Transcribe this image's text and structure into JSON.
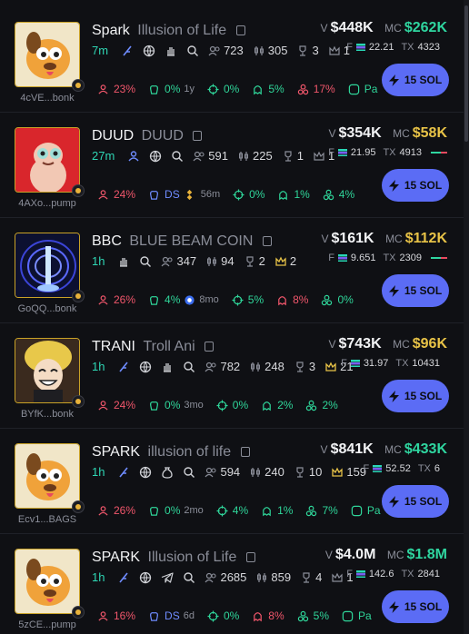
{
  "buy_label": "15 SOL",
  "colors": {
    "accent": "#5b6cf5",
    "green": "#2fd6a0",
    "yellow": "#e8c347",
    "red": "#f0566b"
  },
  "tokens": [
    {
      "address": "4cVE...bonk",
      "symbol": "Spark",
      "name": "Illusion of Life",
      "age": "7m",
      "holders": "723",
      "txns": "305",
      "trophies": "3",
      "crown": "1",
      "volume_label": "V",
      "volume": "$448K",
      "mc_label": "MC",
      "mc": "$262K",
      "mc_color": "green",
      "f_label": "F",
      "fees": "22.21",
      "tx_label": "TX",
      "tx": "4323",
      "top10": "23%",
      "dev": "0%",
      "dev_age": "1y",
      "snipers": "0%",
      "insiders": "5%",
      "bundlers": "17%",
      "paid": "Pa"
    },
    {
      "address": "4AXo...pump",
      "symbol": "DUUD",
      "name": "DUUD",
      "age": "27m",
      "holders": "591",
      "txns": "225",
      "trophies": "1",
      "crown": "1",
      "volume_label": "V",
      "volume": "$354K",
      "mc_label": "MC",
      "mc": "$58K",
      "mc_color": "yellow",
      "f_label": "F",
      "fees": "21.95",
      "tx_label": "TX",
      "tx": "4913",
      "top10": "24%",
      "dev": "DS",
      "dev_age": "56m",
      "snipers": "0%",
      "insiders": "1%",
      "bundlers": "4%",
      "paid": ""
    },
    {
      "address": "GoQQ...bonk",
      "symbol": "BBC",
      "name": "BLUE BEAM COIN",
      "age": "1h",
      "holders": "347",
      "txns": "94",
      "trophies": "2",
      "crown": "2",
      "volume_label": "V",
      "volume": "$161K",
      "mc_label": "MC",
      "mc": "$112K",
      "mc_color": "yellow",
      "f_label": "F",
      "fees": "9.651",
      "tx_label": "TX",
      "tx": "2309",
      "top10": "26%",
      "dev": "4%",
      "dev_age": "8mo",
      "snipers": "5%",
      "insiders": "8%",
      "bundlers": "0%",
      "paid": ""
    },
    {
      "address": "BYfK...bonk",
      "symbol": "TRANI",
      "name": "Troll Ani",
      "age": "1h",
      "holders": "782",
      "txns": "248",
      "trophies": "3",
      "crown": "21",
      "volume_label": "V",
      "volume": "$743K",
      "mc_label": "MC",
      "mc": "$96K",
      "mc_color": "yellow",
      "f_label": "F",
      "fees": "31.97",
      "tx_label": "TX",
      "tx": "10431",
      "top10": "24%",
      "dev": "0%",
      "dev_age": "3mo",
      "snipers": "0%",
      "insiders": "2%",
      "bundlers": "2%",
      "paid": ""
    },
    {
      "address": "Ecv1...BAGS",
      "symbol": "SPARK",
      "name": "illusion of life",
      "age": "1h",
      "holders": "594",
      "txns": "240",
      "trophies": "10",
      "crown": "159",
      "volume_label": "V",
      "volume": "$841K",
      "mc_label": "MC",
      "mc": "$433K",
      "mc_color": "green",
      "f_label": "F",
      "fees": "52.52",
      "tx_label": "TX",
      "tx": "6",
      "top10": "26%",
      "dev": "0%",
      "dev_age": "2mo",
      "snipers": "4%",
      "insiders": "1%",
      "bundlers": "7%",
      "paid": "Pa"
    },
    {
      "address": "5zCE...pump",
      "symbol": "SPARK",
      "name": "Illusion of Life",
      "age": "1h",
      "holders": "2685",
      "txns": "859",
      "trophies": "4",
      "crown": "1",
      "volume_label": "V",
      "volume": "$4.0M",
      "mc_label": "MC",
      "mc": "$1.8M",
      "mc_color": "green",
      "f_label": "F",
      "fees": "142.6",
      "tx_label": "TX",
      "tx": "2841",
      "top10": "16%",
      "dev": "DS",
      "dev_age": "6d",
      "snipers": "0%",
      "insiders": "8%",
      "bundlers": "5%",
      "paid": "Pa"
    }
  ]
}
